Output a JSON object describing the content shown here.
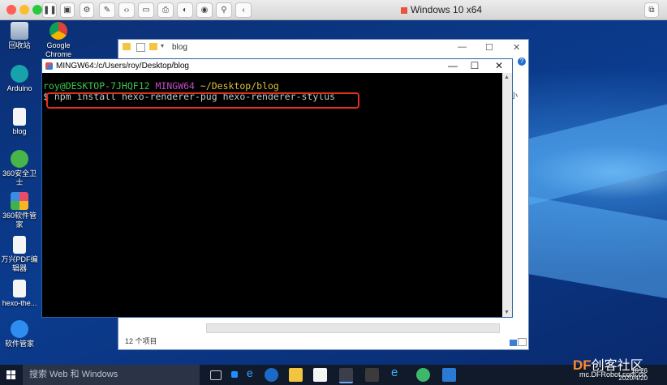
{
  "vm": {
    "title": "Windows 10 x64"
  },
  "desktop_icons": [
    {
      "label": "回收站",
      "icon": "recycle-bin-icon"
    },
    {
      "label": "Google Chrome",
      "icon": "chrome-icon"
    },
    {
      "label": "Arduino",
      "icon": "arduino-icon"
    },
    {
      "label": "blog",
      "icon": "file-icon"
    },
    {
      "label": "360安全卫士",
      "icon": "360-security-icon"
    },
    {
      "label": "360软件管家",
      "icon": "360-software-icon"
    },
    {
      "label": "万兴PDF编辑器",
      "icon": "pdf-editor-icon"
    },
    {
      "label": "hexo-the...",
      "icon": "file-icon"
    },
    {
      "label": "软件管家",
      "icon": "software-manager-icon"
    }
  ],
  "explorer": {
    "title": "blog",
    "status": "12 个项目",
    "side_char": "小"
  },
  "terminal": {
    "title": "MINGW64:/c/Users/roy/Desktop/blog",
    "prompt_user": "roy@DESKTOP-7JHQF12",
    "prompt_env": "MINGW64",
    "prompt_path": "~/Desktop/blog",
    "prompt_symbol": "$",
    "command": "npm install hexo-renderer-pug hexo-renderer-stylus"
  },
  "taskbar": {
    "search_placeholder": "搜索 Web 和 Windows",
    "time": "16:26",
    "date": "2020/4/20"
  },
  "watermark": {
    "brand": "DF",
    "text": "创客社区",
    "url": "mc.DFRobot.com.cn"
  }
}
